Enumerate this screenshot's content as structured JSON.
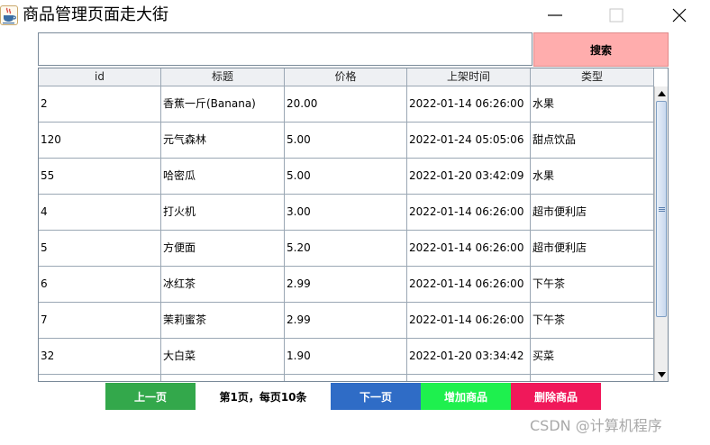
{
  "window": {
    "title": "商品管理页面走大街"
  },
  "search": {
    "value": "",
    "placeholder": "",
    "button_label": "搜索"
  },
  "table": {
    "columns": [
      "id",
      "标题",
      "价格",
      "上架时间",
      "类型"
    ],
    "rows": [
      [
        "2",
        "香蕉一斤(Banana)",
        "20.00",
        "2022-01-14 06:26:00",
        "水果"
      ],
      [
        "120",
        "元气森林",
        "5.00",
        "2022-01-24 05:05:06",
        "甜点饮品"
      ],
      [
        "55",
        "哈密瓜",
        "5.00",
        "2022-01-20 03:42:09",
        "水果"
      ],
      [
        "4",
        "打火机",
        "3.00",
        "2022-01-14 06:26:00",
        "超市便利店"
      ],
      [
        "5",
        "方便面",
        "5.20",
        "2022-01-14 06:26:00",
        "超市便利店"
      ],
      [
        "6",
        "冰红茶",
        "2.99",
        "2022-01-14 06:26:00",
        "下午茶"
      ],
      [
        "7",
        "茉莉蜜茶",
        "2.99",
        "2022-01-14 06:26:00",
        "下午茶"
      ],
      [
        "32",
        "大白菜",
        "1.90",
        "2022-01-20 03:34:42",
        "买菜"
      ],
      [
        "",
        "",
        "",
        "",
        ""
      ]
    ]
  },
  "footer": {
    "prev_label": "上一页",
    "page_info": "第1页，每页10条",
    "next_label": "下一页",
    "add_label": "增加商品",
    "delete_label": "删除商品"
  },
  "watermark": "CSDN @计算机程序",
  "colors": {
    "search_button": "#ffadad",
    "prev_button": "#33a84b",
    "next_button": "#2f6cc6",
    "add_button": "#1ef04e",
    "delete_button": "#f0185a"
  }
}
